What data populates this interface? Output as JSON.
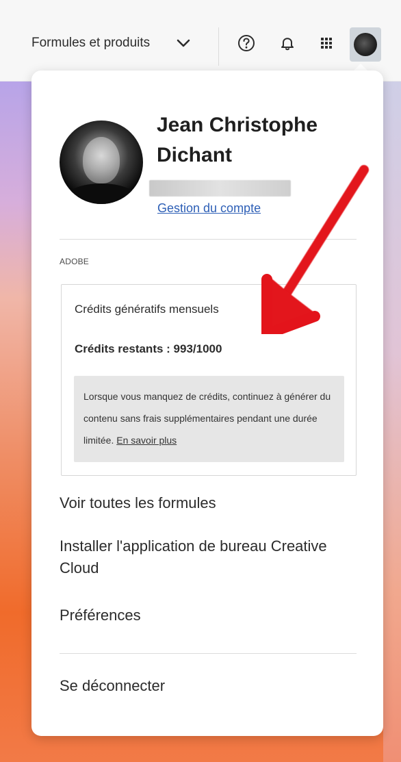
{
  "topbar": {
    "menu_label": "Formules et produits",
    "icons": [
      "chevron-down-icon",
      "help-icon",
      "bell-icon",
      "apps-grid-icon",
      "avatar"
    ]
  },
  "profile": {
    "name_line1": "Jean Christophe",
    "name_line2": "Dichant",
    "account_link": "Gestion du compte"
  },
  "section": {
    "label": "ADOBE"
  },
  "credits": {
    "title": "Crédits génératifs mensuels",
    "remaining": "Crédits restants : 993/1000",
    "note_text": "Lorsque vous manquez de crédits, continuez à générer du contenu sans frais supplémentaires pendant une durée limitée.",
    "note_link": "En savoir plus"
  },
  "menu": {
    "items": [
      "Voir toutes les formules",
      "Installer l'application de bureau Creative Cloud",
      "Préférences"
    ],
    "signout": "Se déconnecter"
  },
  "colors": {
    "link_blue": "#2d5fb6",
    "annotation_red": "#e3141b"
  }
}
